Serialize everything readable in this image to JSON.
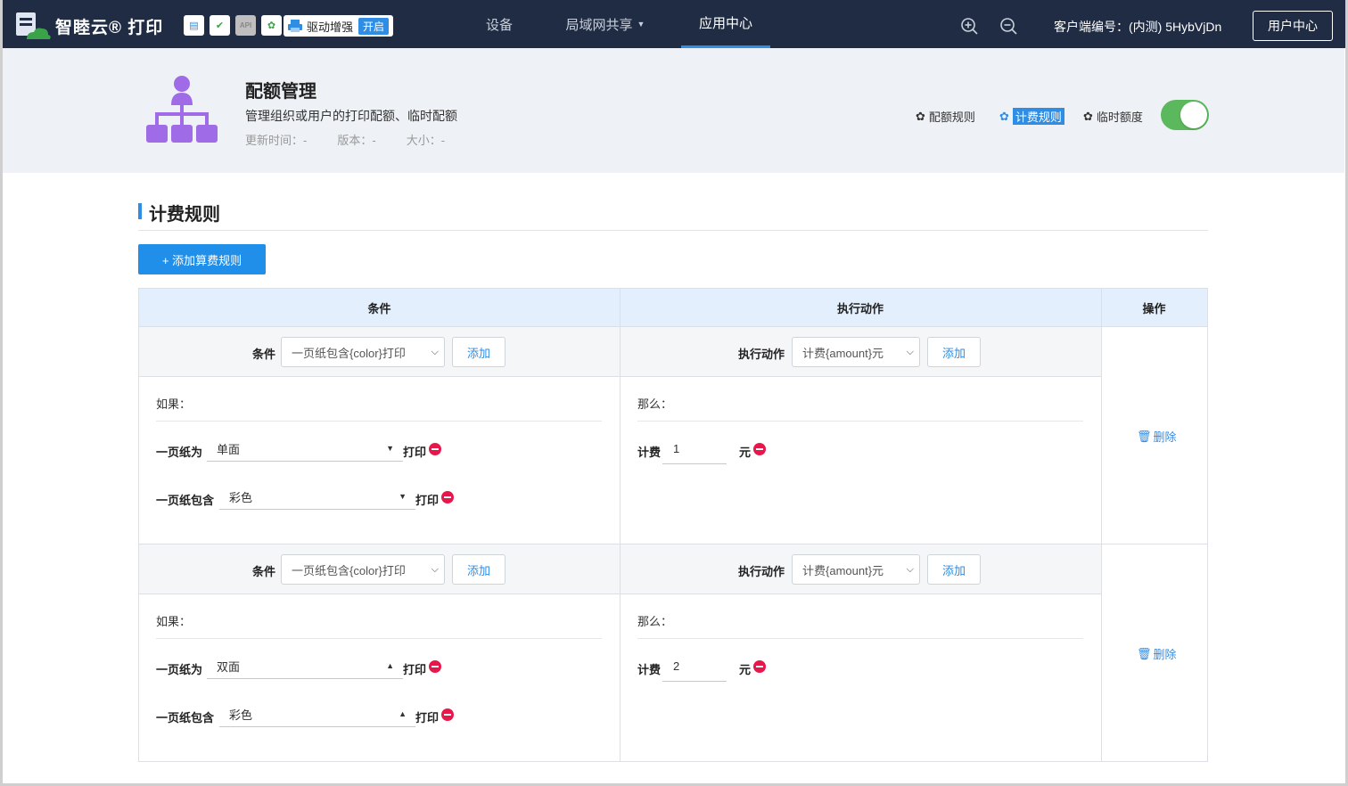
{
  "topbar": {
    "brand": "智睦云® 打印",
    "tool_icons": [
      {
        "name": "server-icon",
        "glyph": "▤",
        "color": "#2f8de4"
      },
      {
        "name": "monitor-check-icon",
        "glyph": "✔",
        "color": "#3aa34a"
      },
      {
        "name": "api-icon",
        "glyph": "API",
        "color": "#888888"
      },
      {
        "name": "gear-green-icon",
        "glyph": "✿",
        "color": "#3aa34a"
      }
    ],
    "driver_label": "驱动增强",
    "driver_state": "开启",
    "nav": [
      "设备",
      "局域网共享",
      "应用中心"
    ],
    "nav_active": "应用中心",
    "client_id": "客户端编号：(内测) 5HybVjDn",
    "user_center": "用户中心"
  },
  "app": {
    "title": "配额管理",
    "description": "管理组织或用户的打印配额、临时配额",
    "updated": "更新时间：-",
    "version": "版本：-",
    "size": "大小：-",
    "links": [
      "配额规则",
      "计费规则",
      "临时额度"
    ],
    "selected_link": "计费规则",
    "toggle_on": true,
    "icon_color": "#a06be6"
  },
  "section": {
    "title": "计费规则",
    "add_button": "+ 添加算费规则"
  },
  "table": {
    "headers": [
      "条件",
      "执行动作",
      "操作"
    ],
    "condition_label": "条件",
    "action_label": "执行动作",
    "add": "添加",
    "if_label": "如果：",
    "then_label": "那么：",
    "print_label": "打印",
    "charge_label": "计费",
    "yuan_label": "元",
    "delete": "删除",
    "rows": [
      {
        "condition_select": "一页纸包含{color}打印",
        "action_select": "计费{amount}元",
        "paper_label": "一页纸为",
        "paper_value": "单面",
        "color_label": "一页纸包含",
        "color_value": "彩色",
        "amount": "1"
      },
      {
        "condition_select": "一页纸包含{color}打印",
        "action_select": "计费{amount}元",
        "paper_label": "一页纸为",
        "paper_value": "双面",
        "color_label": "一页纸包含",
        "color_value": "彩色",
        "amount": "2"
      }
    ]
  }
}
